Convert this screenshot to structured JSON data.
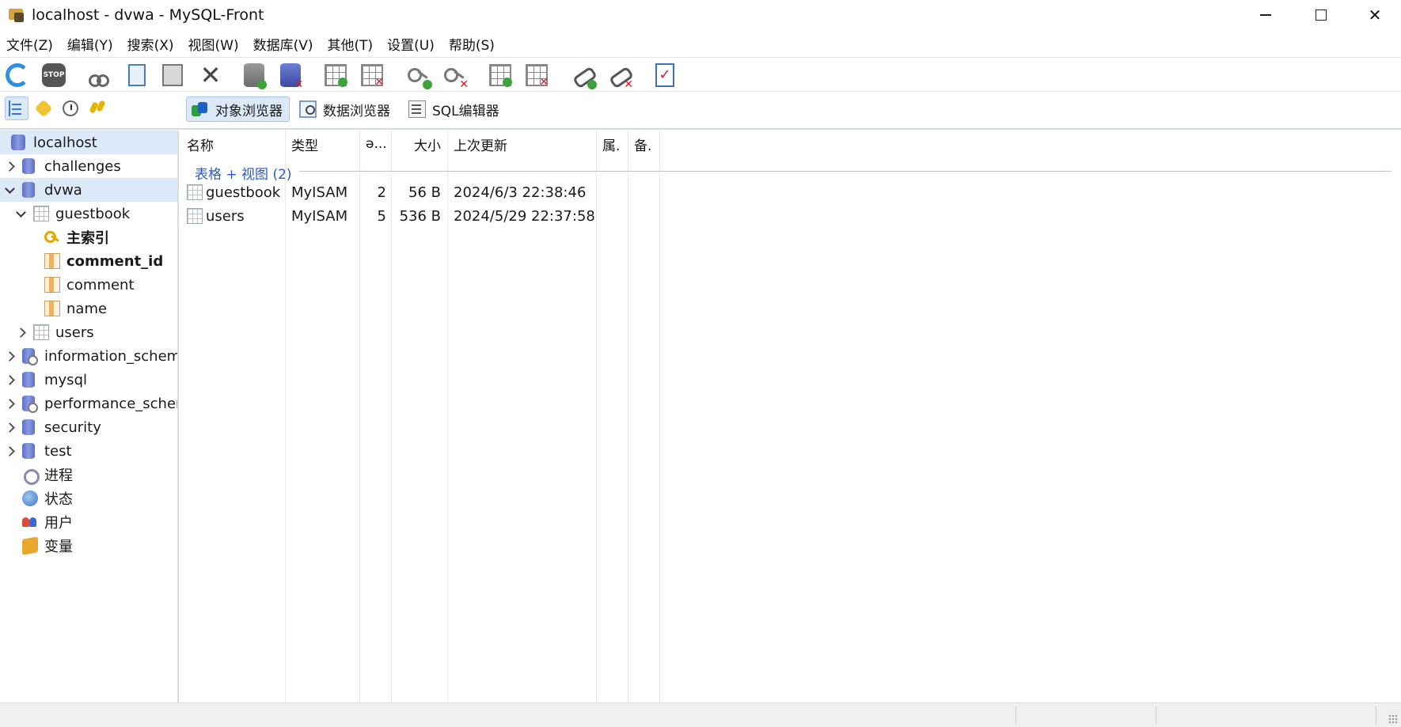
{
  "window": {
    "title": "localhost - dvwa - MySQL-Front",
    "minimize_glyph": "—",
    "close_glyph": "✕"
  },
  "menu": [
    "文件(Z)",
    "编辑(Y)",
    "搜索(X)",
    "视图(W)",
    "数据库(V)",
    "其他(T)",
    "设置(U)",
    "帮助(S)"
  ],
  "toolbar": {
    "icons": [
      "refresh-icon",
      "stop-icon",
      "cut-icon",
      "copy-icon",
      "paste-icon",
      "delete-icon",
      "create-database-icon",
      "drop-database-icon",
      "create-table-icon",
      "drop-table-icon",
      "create-key-icon",
      "drop-key-icon",
      "create-field-icon",
      "drop-field-icon",
      "create-foreign-key-icon",
      "drop-foreign-key-icon",
      "check-icon"
    ],
    "stop_label": "STOP",
    "check_mark": "✓"
  },
  "view_tabs": {
    "object_browser": "对象浏览器",
    "data_browser": "数据浏览器",
    "sql_editor": "SQL编辑器"
  },
  "tree": {
    "items": [
      {
        "label": "localhost",
        "level": 0,
        "icon": "server-icon",
        "selected": true,
        "expander": "none",
        "bold": false
      },
      {
        "label": "challenges",
        "level": 1,
        "icon": "database-icon",
        "selected": false,
        "expander": "collapsed",
        "bold": false
      },
      {
        "label": "dvwa",
        "level": 1,
        "icon": "database-icon",
        "selected": true,
        "expander": "expanded",
        "bold": false
      },
      {
        "label": "guestbook",
        "level": 2,
        "icon": "table-icon",
        "selected": false,
        "expander": "expanded",
        "bold": false
      },
      {
        "label": "主索引",
        "level": 3,
        "icon": "key-icon",
        "selected": false,
        "expander": "none",
        "bold": true
      },
      {
        "label": "comment_id",
        "level": 3,
        "icon": "field-icon",
        "selected": false,
        "expander": "none",
        "bold": true
      },
      {
        "label": "comment",
        "level": 3,
        "icon": "field-icon",
        "selected": false,
        "expander": "none",
        "bold": false
      },
      {
        "label": "name",
        "level": 3,
        "icon": "field-icon",
        "selected": false,
        "expander": "none",
        "bold": false
      },
      {
        "label": "users",
        "level": 2,
        "icon": "table-icon",
        "selected": false,
        "expander": "collapsed",
        "bold": false
      },
      {
        "label": "information_schema",
        "level": 1,
        "icon": "system-database-icon",
        "selected": false,
        "expander": "collapsed",
        "bold": false
      },
      {
        "label": "mysql",
        "level": 1,
        "icon": "database-icon",
        "selected": false,
        "expander": "collapsed",
        "bold": false
      },
      {
        "label": "performance_schema",
        "level": 1,
        "icon": "system-database-icon",
        "selected": false,
        "expander": "collapsed",
        "bold": false
      },
      {
        "label": "security",
        "level": 1,
        "icon": "database-icon",
        "selected": false,
        "expander": "collapsed",
        "bold": false
      },
      {
        "label": "test",
        "level": 1,
        "icon": "database-icon",
        "selected": false,
        "expander": "collapsed",
        "bold": false
      },
      {
        "label": "进程",
        "level": 1,
        "icon": "processes-icon",
        "selected": false,
        "expander": "none",
        "bold": false
      },
      {
        "label": "状态",
        "level": 1,
        "icon": "status-icon",
        "selected": false,
        "expander": "none",
        "bold": false
      },
      {
        "label": "用户",
        "level": 1,
        "icon": "users-icon",
        "selected": false,
        "expander": "none",
        "bold": false
      },
      {
        "label": "变量",
        "level": 1,
        "icon": "variables-icon",
        "selected": false,
        "expander": "none",
        "bold": false
      }
    ]
  },
  "list": {
    "columns": {
      "name": "名称",
      "type": "类型",
      "records": "ə...",
      "size": "大小",
      "updated": "上次更新",
      "attr": "属.",
      "comment": "备."
    },
    "group_label": "表格 + 视图 (2)",
    "rows": [
      {
        "name": "guestbook",
        "type": "MyISAM",
        "records": "2",
        "size": "56 B",
        "updated": "2024/6/3 22:38:46"
      },
      {
        "name": "users",
        "type": "MyISAM",
        "records": "5",
        "size": "536 B",
        "updated": "2024/5/29 22:37:58"
      }
    ]
  },
  "colors": {
    "accent": "#2a5cc4",
    "selection": "#dce9f8"
  }
}
